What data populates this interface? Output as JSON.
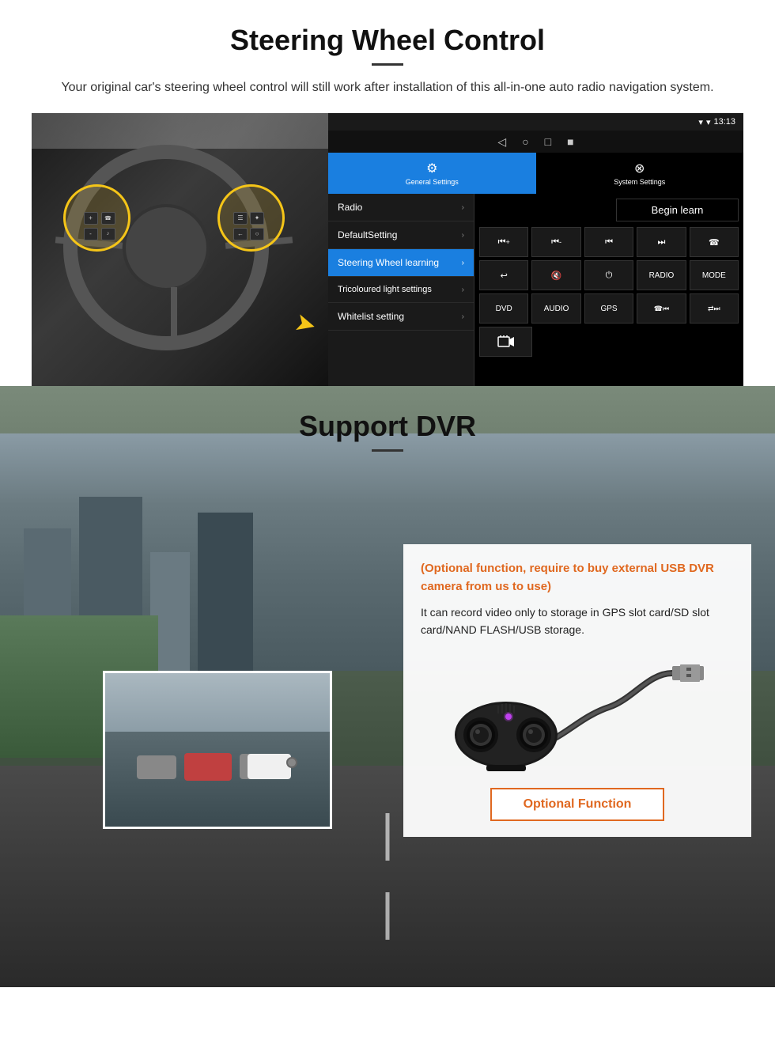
{
  "steering": {
    "title": "Steering Wheel Control",
    "subtitle": "Your original car's steering wheel control will still work after installation of this all-in-one auto radio navigation system.",
    "status_bar": {
      "time": "13:13",
      "icons": [
        "▾",
        "▾",
        "●"
      ]
    },
    "nav_icons": [
      "◁",
      "○",
      "□",
      "■"
    ],
    "tabs": [
      {
        "icon": "⚙",
        "label": "General Settings",
        "active": true
      },
      {
        "icon": "⊗",
        "label": "System Settings",
        "active": false
      }
    ],
    "menu_items": [
      {
        "label": "Radio",
        "active": false
      },
      {
        "label": "DefaultSetting",
        "active": false
      },
      {
        "label": "Steering Wheel learning",
        "active": true
      },
      {
        "label": "Tricoloured light settings",
        "active": false
      },
      {
        "label": "Whitelist setting",
        "active": false
      }
    ],
    "begin_learn": "Begin learn",
    "control_buttons_row1": [
      "⏮+",
      "⏮-",
      "⏮",
      "⏭",
      "☎"
    ],
    "control_buttons_row2": [
      "↩",
      "🔇",
      "⏻",
      "RADIO",
      "MODE"
    ],
    "control_buttons_row3": [
      "DVD",
      "AUDIO",
      "GPS",
      "⏮⏭",
      "🔀⏭"
    ],
    "control_buttons_row4": [
      "⏺"
    ]
  },
  "dvr": {
    "title": "Support DVR",
    "card_title": "(Optional function, require to buy external USB DVR camera from us to use)",
    "card_text": "It can record video only to storage in GPS slot card/SD slot card/NAND FLASH/USB storage.",
    "optional_btn": "Optional Function"
  }
}
